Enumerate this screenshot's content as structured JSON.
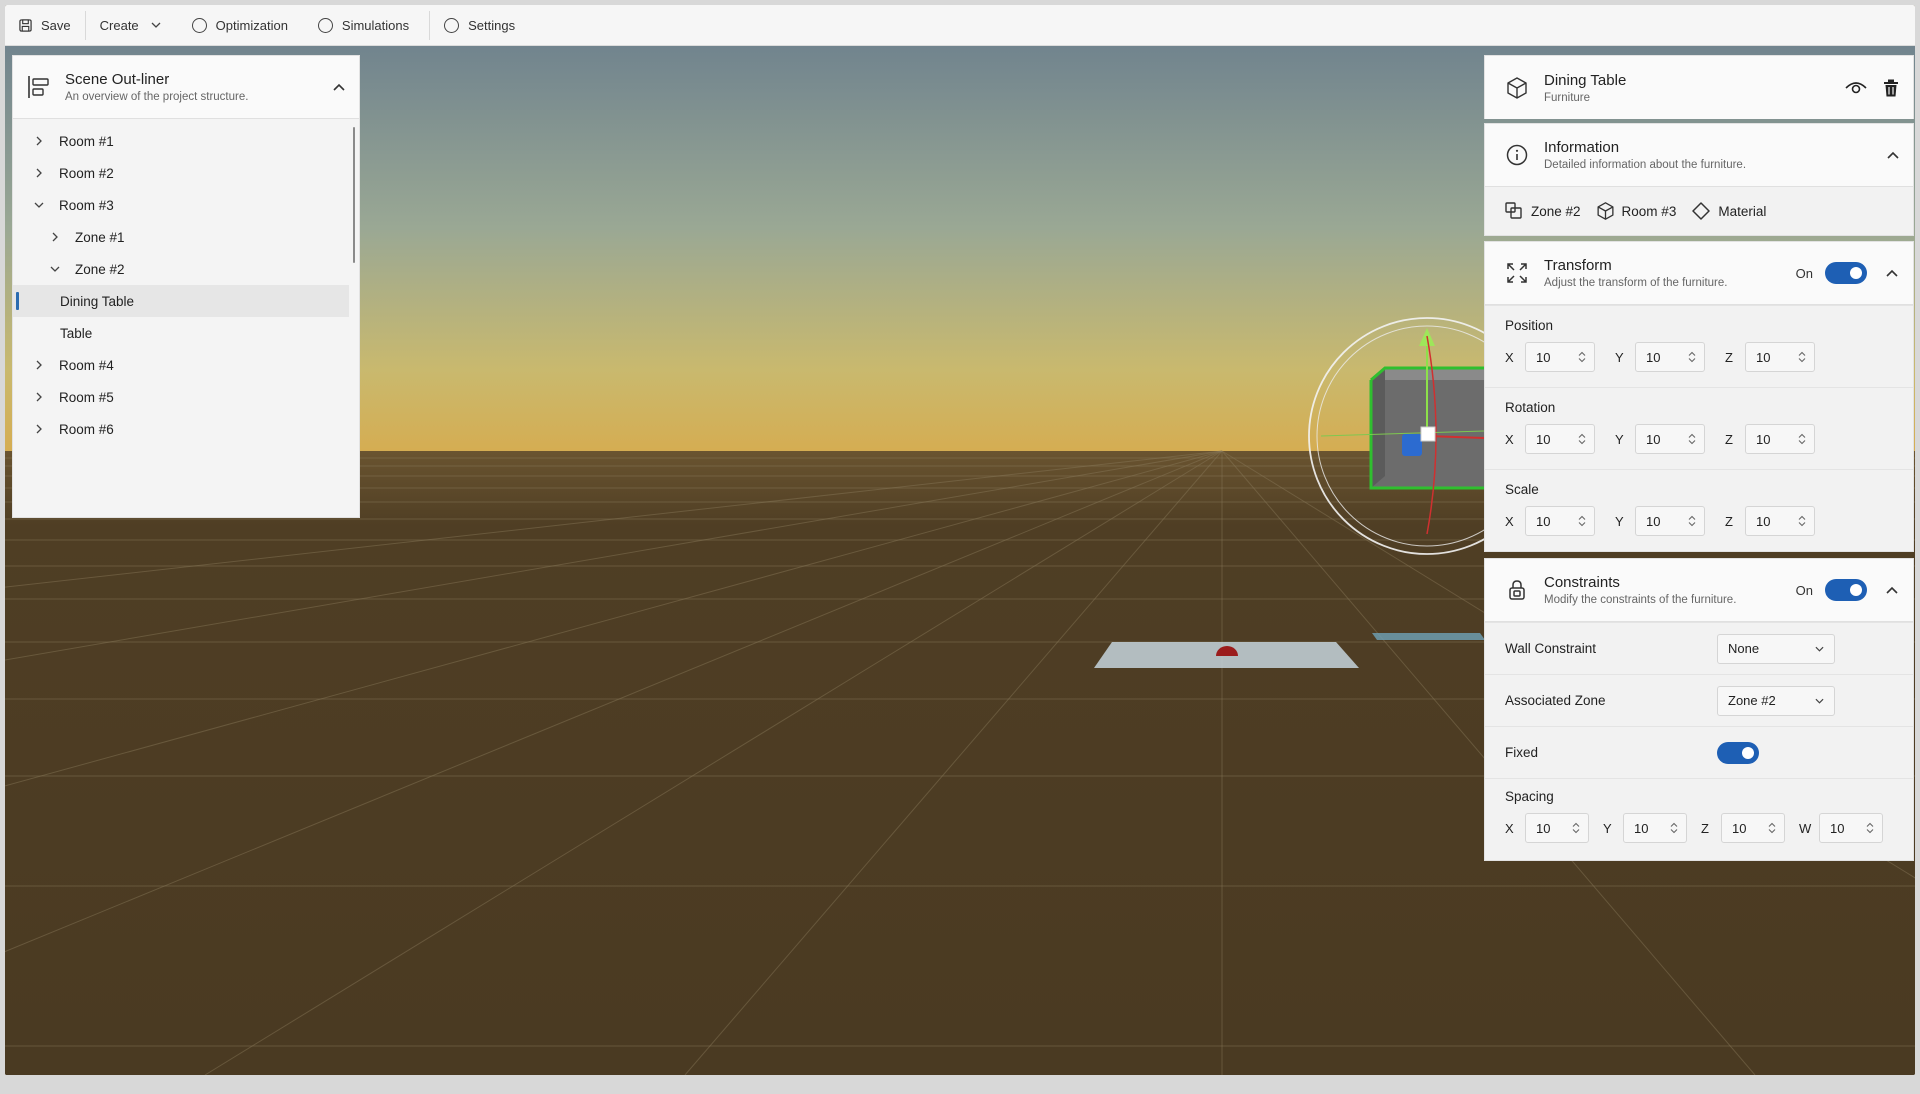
{
  "toolbar": {
    "save": "Save",
    "create": "Create",
    "optimization": "Optimization",
    "simulations": "Simulations",
    "settings": "Settings"
  },
  "outliner": {
    "title": "Scene Out-liner",
    "subtitle": "An overview of the project structure.",
    "items": [
      {
        "label": "Room #1",
        "level": 0,
        "chevron": "right"
      },
      {
        "label": "Room #2",
        "level": 0,
        "chevron": "right"
      },
      {
        "label": "Room #3",
        "level": 0,
        "chevron": "down"
      },
      {
        "label": "Zone #1",
        "level": 1,
        "chevron": "right"
      },
      {
        "label": "Zone #2",
        "level": 1,
        "chevron": "down"
      },
      {
        "label": "Dining Table",
        "level": 2,
        "chevron": "none",
        "selected": true
      },
      {
        "label": "Table",
        "level": 2,
        "chevron": "none"
      },
      {
        "label": "Room #4",
        "level": 0,
        "chevron": "right"
      },
      {
        "label": "Room #5",
        "level": 0,
        "chevron": "right"
      },
      {
        "label": "Room #6",
        "level": 0,
        "chevron": "right"
      }
    ]
  },
  "object": {
    "name": "Dining Table",
    "category": "Furniture"
  },
  "information": {
    "title": "Information",
    "subtitle": "Detailed information about the furniture.",
    "zone": "Zone #2",
    "room": "Room #3",
    "material": "Material"
  },
  "transform": {
    "title": "Transform",
    "subtitle": "Adjust the transform of the furniture.",
    "state": "On",
    "position_label": "Position",
    "rotation_label": "Rotation",
    "scale_label": "Scale",
    "axes": [
      "X",
      "Y",
      "Z"
    ],
    "position": [
      "10",
      "10",
      "10"
    ],
    "rotation": [
      "10",
      "10",
      "10"
    ],
    "scale": [
      "10",
      "10",
      "10"
    ]
  },
  "constraints": {
    "title": "Constraints",
    "subtitle": "Modify the constraints of the furniture.",
    "state": "On",
    "wall_label": "Wall Constraint",
    "wall_value": "None",
    "zone_label": "Associated Zone",
    "zone_value": "Zone #2",
    "fixed_label": "Fixed",
    "fixed": true,
    "spacing_label": "Spacing",
    "spacing_axes": [
      "X",
      "Y",
      "Z",
      "W"
    ],
    "spacing": [
      "10",
      "10",
      "10",
      "10"
    ]
  },
  "colors": {
    "accent": "#1e5fb4",
    "ground": "#4a3a22",
    "sky_top": "#71848e",
    "horizon": "#d7b35a"
  }
}
